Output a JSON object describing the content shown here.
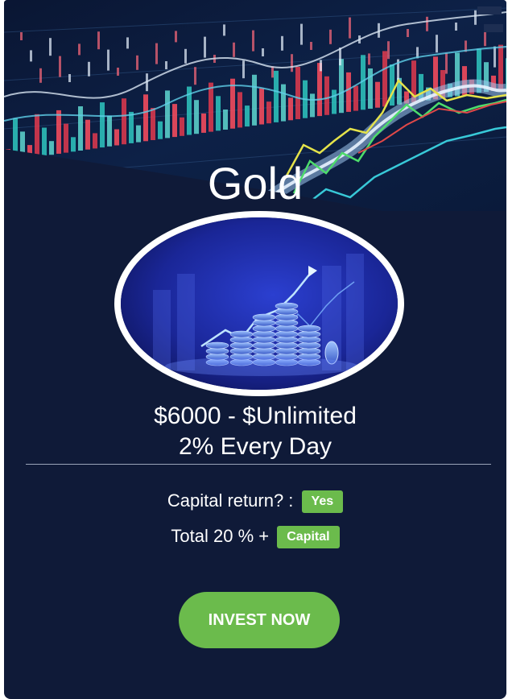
{
  "plan": {
    "name": "Gold",
    "price_range": "$6000 - $Unlimited",
    "rate": "2% Every Day"
  },
  "details": {
    "capital_return_label": "Capital return? :",
    "capital_return_value": "Yes",
    "total_label": "Total 20 % +",
    "total_value": "Capital"
  },
  "cta": {
    "label": "INVEST NOW"
  },
  "colors": {
    "card_bg": "#0f1a38",
    "accent_green": "#6bbb4c",
    "text": "#ffffff"
  }
}
